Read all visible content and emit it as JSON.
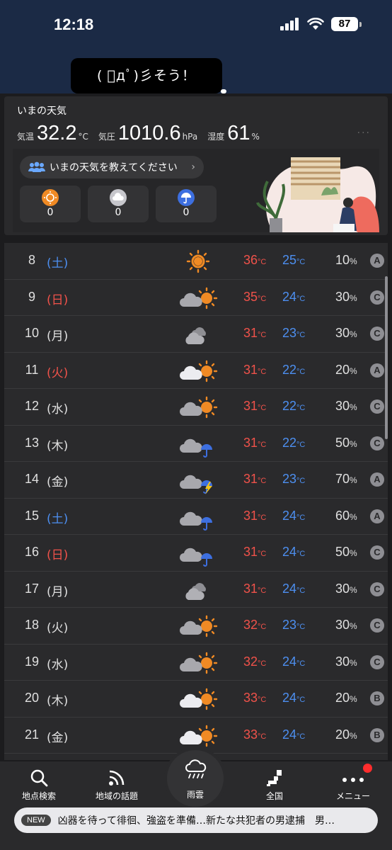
{
  "status_bar": {
    "time": "12:18",
    "battery": "87"
  },
  "toast": {
    "text": "( ﾟдﾟ)彡そう！"
  },
  "now_weather": {
    "title": "いまの天気",
    "temp_label": "気温",
    "temp_value": "32.2",
    "temp_unit": "°C",
    "pressure_label": "気圧",
    "pressure_value": "1010.6",
    "pressure_unit": "hPa",
    "humidity_label": "湿度",
    "humidity_value": "61",
    "humidity_unit": "%",
    "ask_label": "いまの天気を教えてください",
    "reports": [
      {
        "icon": "sun-report-icon",
        "count": "0",
        "color": "#f08a24"
      },
      {
        "icon": "cloud-report-icon",
        "count": "0",
        "color": "#c7c7cc"
      },
      {
        "icon": "rain-report-icon",
        "count": "0",
        "color": "#3d6fe0"
      }
    ]
  },
  "forecast": {
    "temp_unit": "°C",
    "pop_unit": "%",
    "rows": [
      {
        "day": "8",
        "dow": "(土)",
        "dow_type": "sat",
        "icon": "sunny",
        "high": "36",
        "low": "25",
        "pop": "10",
        "grade": "A"
      },
      {
        "day": "9",
        "dow": "(日)",
        "dow_type": "sun",
        "icon": "cloud-sun",
        "high": "35",
        "low": "24",
        "pop": "30",
        "grade": "C"
      },
      {
        "day": "10",
        "dow": "(月)",
        "dow_type": "wd",
        "icon": "cloudy",
        "high": "31",
        "low": "23",
        "pop": "30",
        "grade": "C"
      },
      {
        "day": "11",
        "dow": "(火)",
        "dow_type": "sun",
        "icon": "wcloud-sun",
        "high": "31",
        "low": "22",
        "pop": "20",
        "grade": "A"
      },
      {
        "day": "12",
        "dow": "(水)",
        "dow_type": "wd",
        "icon": "cloud-sun",
        "high": "31",
        "low": "22",
        "pop": "30",
        "grade": "C"
      },
      {
        "day": "13",
        "dow": "(木)",
        "dow_type": "wd",
        "icon": "cloud-rain",
        "high": "31",
        "low": "22",
        "pop": "50",
        "grade": "C"
      },
      {
        "day": "14",
        "dow": "(金)",
        "dow_type": "wd",
        "icon": "cloud-storm",
        "high": "31",
        "low": "23",
        "pop": "70",
        "grade": "A"
      },
      {
        "day": "15",
        "dow": "(土)",
        "dow_type": "sat",
        "icon": "cloud-rain",
        "high": "31",
        "low": "24",
        "pop": "60",
        "grade": "A"
      },
      {
        "day": "16",
        "dow": "(日)",
        "dow_type": "sun",
        "icon": "cloud-rain",
        "high": "31",
        "low": "24",
        "pop": "50",
        "grade": "C"
      },
      {
        "day": "17",
        "dow": "(月)",
        "dow_type": "wd",
        "icon": "cloudy",
        "high": "31",
        "low": "24",
        "pop": "30",
        "grade": "C"
      },
      {
        "day": "18",
        "dow": "(火)",
        "dow_type": "wd",
        "icon": "cloud-sun",
        "high": "32",
        "low": "23",
        "pop": "30",
        "grade": "C"
      },
      {
        "day": "19",
        "dow": "(水)",
        "dow_type": "wd",
        "icon": "cloud-sun",
        "high": "32",
        "low": "24",
        "pop": "30",
        "grade": "C"
      },
      {
        "day": "20",
        "dow": "(木)",
        "dow_type": "wd",
        "icon": "wcloud-sun",
        "high": "33",
        "low": "24",
        "pop": "20",
        "grade": "B"
      },
      {
        "day": "21",
        "dow": "(金)",
        "dow_type": "wd",
        "icon": "wcloud-sun",
        "high": "33",
        "low": "24",
        "pop": "20",
        "grade": "B"
      }
    ]
  },
  "tabs": {
    "search": "地点検索",
    "topics": "地域の話題",
    "rain": "雨雲",
    "national": "全国",
    "menu": "メニュー"
  },
  "news": {
    "tag": "NEW",
    "headline": "凶器を待って徘徊、強盗を準備…新たな共犯者の男逮捕　男…"
  },
  "colors": {
    "high": "#f0524a",
    "low": "#4d8ff0",
    "sun": "#f08a24",
    "rain": "#3d6fe0"
  }
}
